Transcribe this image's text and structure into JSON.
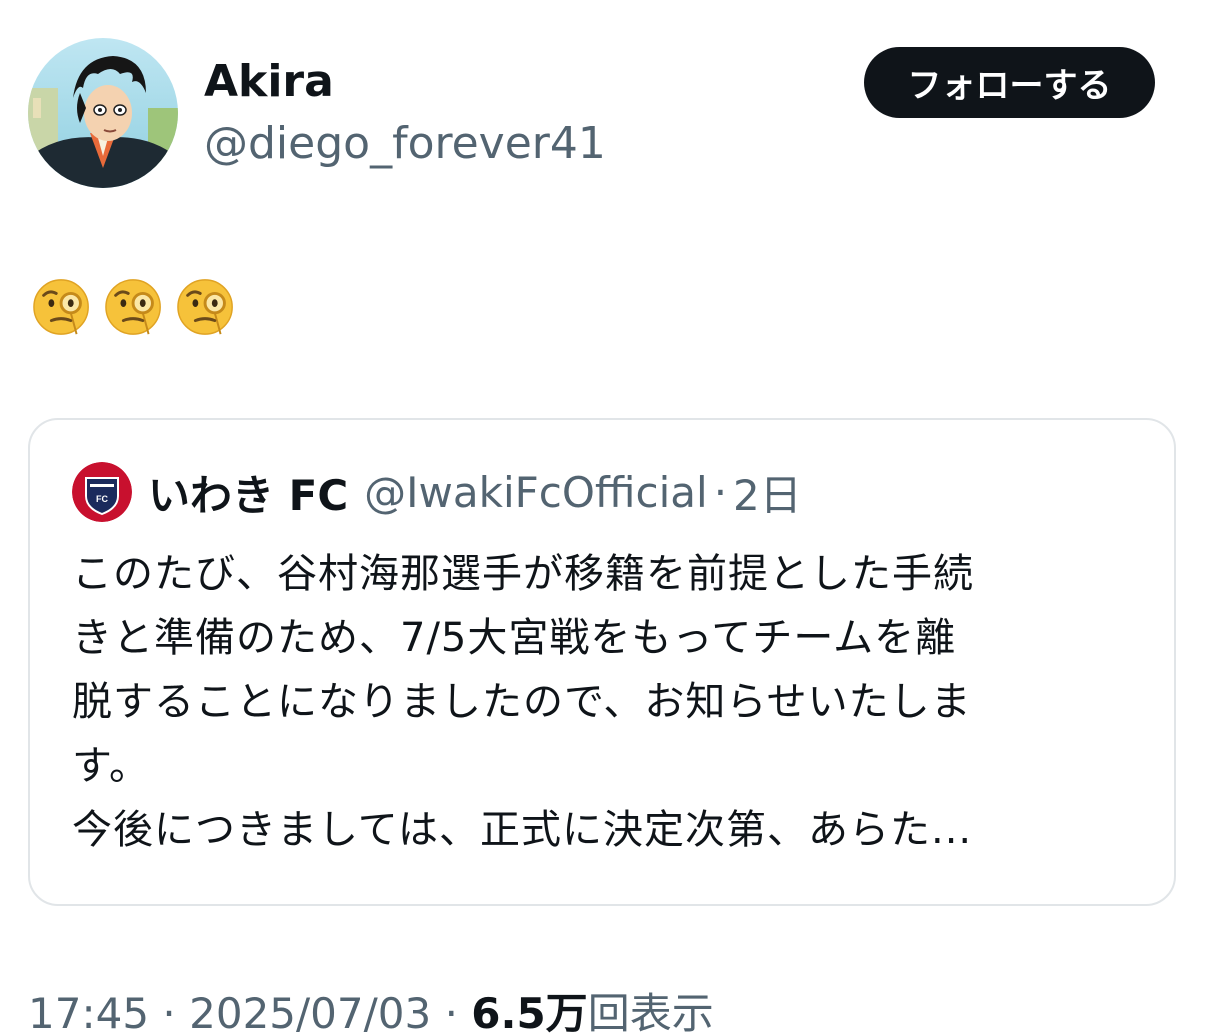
{
  "author": {
    "display_name": "Akira",
    "handle": "@diego_forever41",
    "avatar_icon": "anime-character-avatar-icon"
  },
  "follow_button": {
    "label": "フォローする"
  },
  "tweet": {
    "emoji_icon": "face-with-monocle-icon",
    "emoji_count": 3
  },
  "quoted_tweet": {
    "avatar_icon": "iwaki-fc-crest-icon",
    "name": "いわき FC",
    "handle": "@IwakiFcOfficial",
    "separator": "·",
    "time": "2日",
    "body": "このたび、谷村海那選手が移籍を前提とした手続\nきと準備のため、7/5大宮戦をもってチームを離\n脱することになりましたので、お知らせいたしま\nす。\n今後につきましては、正式に決定次第、あらた..."
  },
  "meta": {
    "time": "17:45",
    "separator": "·",
    "date": "2025/07/03",
    "views_count": "6.5万",
    "views_label": "回表示"
  },
  "colors": {
    "text_primary": "#0f1419",
    "text_secondary": "#536471",
    "button_bg": "#0f1419",
    "card_border": "#e1e5e8"
  }
}
